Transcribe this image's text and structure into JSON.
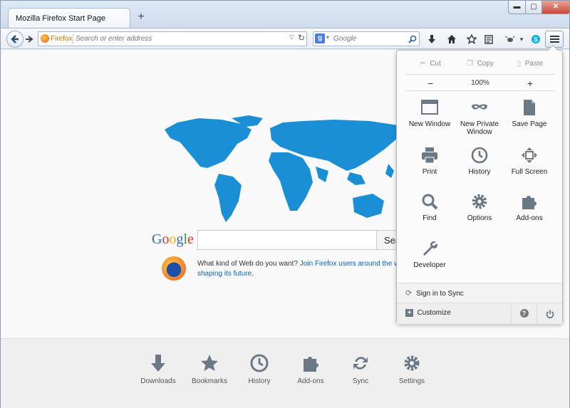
{
  "window": {
    "tab_title": "Mozilla Firefox Start Page",
    "new_tab_label": "+",
    "minimize": "▬",
    "maximize": "▢",
    "close": "✕"
  },
  "navbar": {
    "identity_label": "Firefox",
    "url_placeholder": "Search or enter address",
    "search_engine": "Google",
    "search_placeholder": "Google"
  },
  "start_page": {
    "logo_text": "Google",
    "search_button": "Sea",
    "snippet_text": "What kind of Web do you want? ",
    "snippet_link": "Join Firefox users around the world",
    "snippet_link2": "shaping its future",
    "snippet_end": "."
  },
  "launcher": {
    "items": [
      {
        "label": "Downloads",
        "icon": "download-icon"
      },
      {
        "label": "Bookmarks",
        "icon": "star-icon"
      },
      {
        "label": "History",
        "icon": "clock-icon"
      },
      {
        "label": "Add-ons",
        "icon": "puzzle-icon"
      },
      {
        "label": "Sync",
        "icon": "sync-icon"
      },
      {
        "label": "Settings",
        "icon": "gear-icon"
      }
    ]
  },
  "panel": {
    "edit": {
      "cut": "Cut",
      "copy": "Copy",
      "paste": "Paste"
    },
    "zoom": {
      "out": "−",
      "level": "100%",
      "in": "+"
    },
    "items": [
      {
        "label": "New Window",
        "icon": "window-icon"
      },
      {
        "label": "New Private Window",
        "icon": "mask-icon"
      },
      {
        "label": "Save Page",
        "icon": "page-icon"
      },
      {
        "label": "Print",
        "icon": "printer-icon"
      },
      {
        "label": "History",
        "icon": "clock-icon"
      },
      {
        "label": "Full Screen",
        "icon": "fullscreen-icon"
      },
      {
        "label": "Find",
        "icon": "magnifier-icon"
      },
      {
        "label": "Options",
        "icon": "gear-icon"
      },
      {
        "label": "Add-ons",
        "icon": "puzzle-icon"
      },
      {
        "label": "Developer",
        "icon": "wrench-icon"
      }
    ],
    "sync_label": "Sign in to Sync",
    "customize_label": "Customize",
    "help_label": "?"
  },
  "colors": {
    "accent": "#0a61c2",
    "map": "#1a8fd6",
    "icon": "#6b7886",
    "firefox_orange": "#d36d00"
  }
}
